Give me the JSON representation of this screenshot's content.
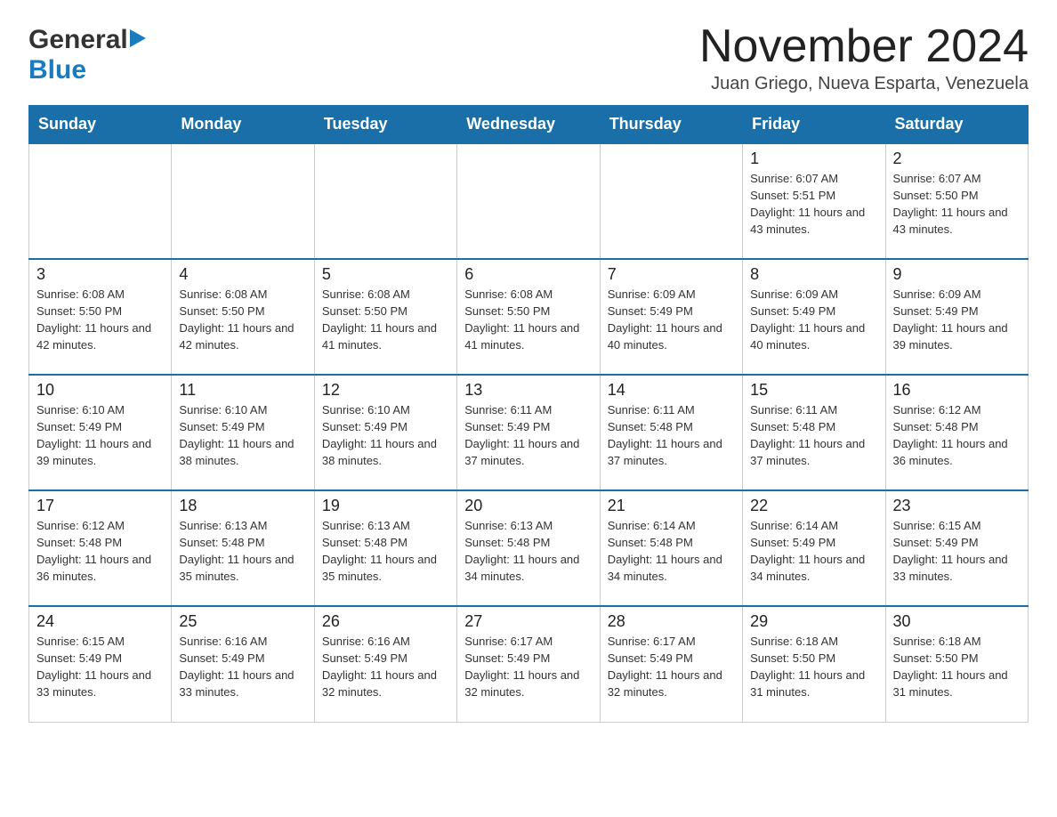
{
  "header": {
    "logo_general": "General",
    "logo_blue": "Blue",
    "title": "November 2024",
    "subtitle": "Juan Griego, Nueva Esparta, Venezuela"
  },
  "calendar": {
    "days_of_week": [
      "Sunday",
      "Monday",
      "Tuesday",
      "Wednesday",
      "Thursday",
      "Friday",
      "Saturday"
    ],
    "weeks": [
      [
        {
          "day": "",
          "info": ""
        },
        {
          "day": "",
          "info": ""
        },
        {
          "day": "",
          "info": ""
        },
        {
          "day": "",
          "info": ""
        },
        {
          "day": "",
          "info": ""
        },
        {
          "day": "1",
          "info": "Sunrise: 6:07 AM\nSunset: 5:51 PM\nDaylight: 11 hours and 43 minutes."
        },
        {
          "day": "2",
          "info": "Sunrise: 6:07 AM\nSunset: 5:50 PM\nDaylight: 11 hours and 43 minutes."
        }
      ],
      [
        {
          "day": "3",
          "info": "Sunrise: 6:08 AM\nSunset: 5:50 PM\nDaylight: 11 hours and 42 minutes."
        },
        {
          "day": "4",
          "info": "Sunrise: 6:08 AM\nSunset: 5:50 PM\nDaylight: 11 hours and 42 minutes."
        },
        {
          "day": "5",
          "info": "Sunrise: 6:08 AM\nSunset: 5:50 PM\nDaylight: 11 hours and 41 minutes."
        },
        {
          "day": "6",
          "info": "Sunrise: 6:08 AM\nSunset: 5:50 PM\nDaylight: 11 hours and 41 minutes."
        },
        {
          "day": "7",
          "info": "Sunrise: 6:09 AM\nSunset: 5:49 PM\nDaylight: 11 hours and 40 minutes."
        },
        {
          "day": "8",
          "info": "Sunrise: 6:09 AM\nSunset: 5:49 PM\nDaylight: 11 hours and 40 minutes."
        },
        {
          "day": "9",
          "info": "Sunrise: 6:09 AM\nSunset: 5:49 PM\nDaylight: 11 hours and 39 minutes."
        }
      ],
      [
        {
          "day": "10",
          "info": "Sunrise: 6:10 AM\nSunset: 5:49 PM\nDaylight: 11 hours and 39 minutes."
        },
        {
          "day": "11",
          "info": "Sunrise: 6:10 AM\nSunset: 5:49 PM\nDaylight: 11 hours and 38 minutes."
        },
        {
          "day": "12",
          "info": "Sunrise: 6:10 AM\nSunset: 5:49 PM\nDaylight: 11 hours and 38 minutes."
        },
        {
          "day": "13",
          "info": "Sunrise: 6:11 AM\nSunset: 5:49 PM\nDaylight: 11 hours and 37 minutes."
        },
        {
          "day": "14",
          "info": "Sunrise: 6:11 AM\nSunset: 5:48 PM\nDaylight: 11 hours and 37 minutes."
        },
        {
          "day": "15",
          "info": "Sunrise: 6:11 AM\nSunset: 5:48 PM\nDaylight: 11 hours and 37 minutes."
        },
        {
          "day": "16",
          "info": "Sunrise: 6:12 AM\nSunset: 5:48 PM\nDaylight: 11 hours and 36 minutes."
        }
      ],
      [
        {
          "day": "17",
          "info": "Sunrise: 6:12 AM\nSunset: 5:48 PM\nDaylight: 11 hours and 36 minutes."
        },
        {
          "day": "18",
          "info": "Sunrise: 6:13 AM\nSunset: 5:48 PM\nDaylight: 11 hours and 35 minutes."
        },
        {
          "day": "19",
          "info": "Sunrise: 6:13 AM\nSunset: 5:48 PM\nDaylight: 11 hours and 35 minutes."
        },
        {
          "day": "20",
          "info": "Sunrise: 6:13 AM\nSunset: 5:48 PM\nDaylight: 11 hours and 34 minutes."
        },
        {
          "day": "21",
          "info": "Sunrise: 6:14 AM\nSunset: 5:48 PM\nDaylight: 11 hours and 34 minutes."
        },
        {
          "day": "22",
          "info": "Sunrise: 6:14 AM\nSunset: 5:49 PM\nDaylight: 11 hours and 34 minutes."
        },
        {
          "day": "23",
          "info": "Sunrise: 6:15 AM\nSunset: 5:49 PM\nDaylight: 11 hours and 33 minutes."
        }
      ],
      [
        {
          "day": "24",
          "info": "Sunrise: 6:15 AM\nSunset: 5:49 PM\nDaylight: 11 hours and 33 minutes."
        },
        {
          "day": "25",
          "info": "Sunrise: 6:16 AM\nSunset: 5:49 PM\nDaylight: 11 hours and 33 minutes."
        },
        {
          "day": "26",
          "info": "Sunrise: 6:16 AM\nSunset: 5:49 PM\nDaylight: 11 hours and 32 minutes."
        },
        {
          "day": "27",
          "info": "Sunrise: 6:17 AM\nSunset: 5:49 PM\nDaylight: 11 hours and 32 minutes."
        },
        {
          "day": "28",
          "info": "Sunrise: 6:17 AM\nSunset: 5:49 PM\nDaylight: 11 hours and 32 minutes."
        },
        {
          "day": "29",
          "info": "Sunrise: 6:18 AM\nSunset: 5:50 PM\nDaylight: 11 hours and 31 minutes."
        },
        {
          "day": "30",
          "info": "Sunrise: 6:18 AM\nSunset: 5:50 PM\nDaylight: 11 hours and 31 minutes."
        }
      ]
    ]
  }
}
